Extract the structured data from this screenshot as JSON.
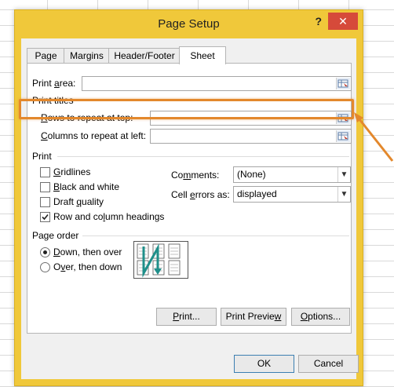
{
  "dialog": {
    "title": "Page Setup",
    "help": "?",
    "close": "✕"
  },
  "tabs": [
    "Page",
    "Margins",
    "Header/Footer",
    "Sheet"
  ],
  "active_tab": "Sheet",
  "print_area": {
    "label_pre": "Print ",
    "label_u": "a",
    "label_post": "rea:",
    "value": ""
  },
  "print_titles": {
    "heading": "Print titles",
    "rows_label_u": "R",
    "rows_label_rest": "ows to repeat at top:",
    "rows_value": "",
    "cols_label_u": "C",
    "cols_label_rest": "olumns to repeat at left:",
    "cols_value": ""
  },
  "print": {
    "heading": "Print",
    "gridlines": {
      "u": "G",
      "rest": "ridlines",
      "checked": false
    },
    "black_white": {
      "u": "B",
      "rest": "lack and white",
      "checked": false
    },
    "draft": {
      "pre": "Draft ",
      "u": "q",
      "rest": "uality",
      "checked": false
    },
    "headings": {
      "pre": "Row and co",
      "u": "l",
      "rest": "umn headings",
      "checked": true
    },
    "comments": {
      "pre": "Co",
      "u": "m",
      "rest": "ments:",
      "value": "(None)"
    },
    "cell_errors": {
      "pre": "Cell ",
      "u": "e",
      "rest": "rrors as:",
      "value": "displayed"
    }
  },
  "page_order": {
    "heading": "Page order",
    "down": {
      "u": "D",
      "rest": "own, then over",
      "selected": true
    },
    "over": {
      "pre": "O",
      "u": "v",
      "rest": "er, then down",
      "selected": false
    }
  },
  "buttons": {
    "print": {
      "u": "P",
      "rest": "rint..."
    },
    "preview": {
      "pre": "Print Previe",
      "u": "w",
      "rest": ""
    },
    "options": {
      "u": "O",
      "rest": "ptions..."
    },
    "ok": "OK",
    "cancel": "Cancel"
  },
  "colors": {
    "accent": "#e3882c",
    "titlebar": "#f0c83a",
    "close": "#d64a3a"
  }
}
